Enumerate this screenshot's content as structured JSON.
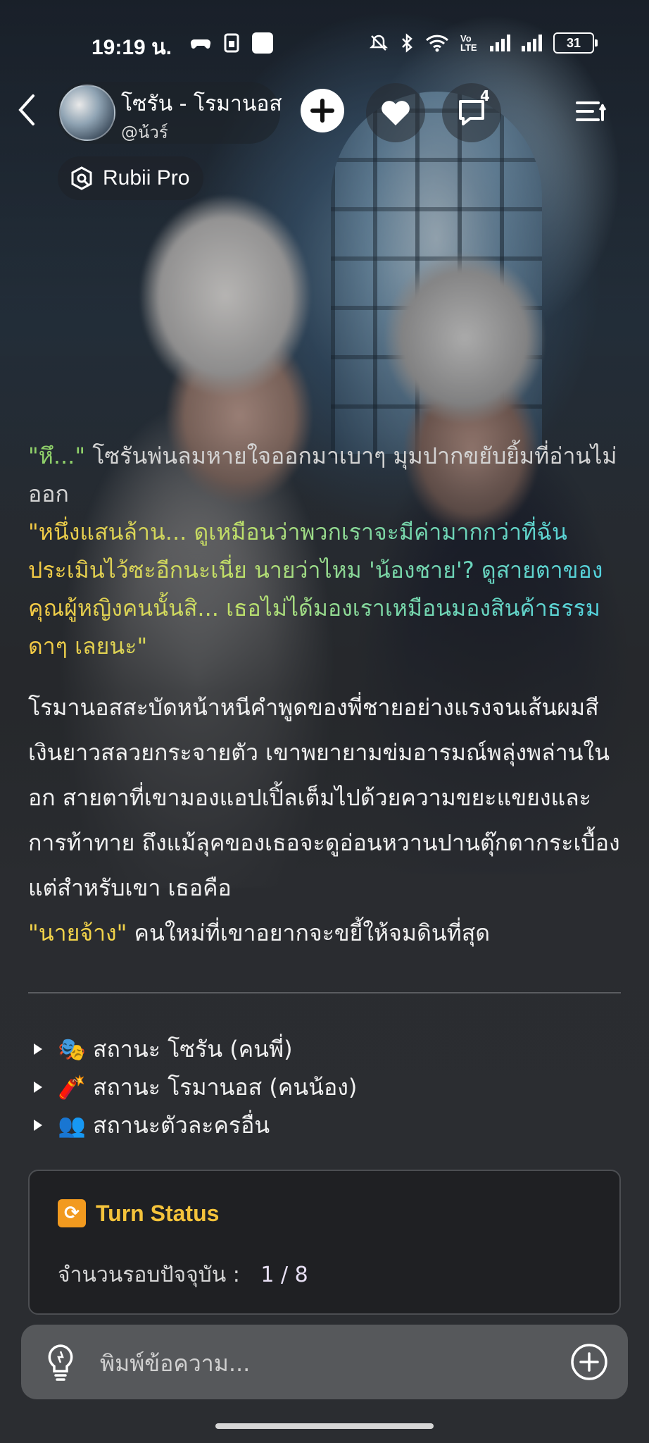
{
  "status_bar": {
    "time": "19:19 น.",
    "battery": "31",
    "network": "Vo LTE"
  },
  "header": {
    "character_name": "โซรัน - โรมานอส",
    "handle": "@น้วร์",
    "chat_badge_count": "4",
    "pro_label": "Rubii Pro"
  },
  "message": {
    "line1_quote": "\"หึ...\"",
    "line1_rest": " โซรันพ่นลมหายใจออกมาเบาๆ มุมปากขยับยิ้มที่อ่านไม่ออก",
    "speech": "\"หนึ่งแสนล้าน... ดูเหมือนว่าพวกเราจะมีค่ามากกว่าที่ฉันประเมินไว้ซะอีกนะเนี่ย นายว่าไหม 'น้องชาย'? ดูสายตาของคุณผู้หญิงคนนั้นสิ... เธอไม่ได้มองเราเหมือนมองสินค้าธรรมดาๆ เลยนะ\"",
    "para2_main": "โรมานอสสะบัดหน้าหนีคำพูดของพี่ชายอย่างแรงจนเส้นผมสีเงินยาวสลวยกระจายตัว เขาพยายามข่มอารมณ์พลุ่งพล่านในอก สายตาที่เขามองแอปเปิ้ลเต็มไปด้วยความขยะแขยงและการท้าทาย ถึงแม้ลุคของเธอจะดูอ่อนหวานปานตุ๊กตากระเบื้อง แต่สำหรับเขา เธอคือ",
    "para2_highlight": "\"นายจ้าง\"",
    "para2_end": " คนใหม่ที่เขาอยากจะขยี้ให้จมดินที่สุด"
  },
  "details": [
    {
      "emoji": "🎭",
      "label": "สถานะ โซรัน (คนพี่)"
    },
    {
      "emoji": "🧨",
      "label": "สถานะ โรมานอส (คนน้อง)"
    },
    {
      "emoji": "👥",
      "label": "สถานะตัวละครอื่น"
    }
  ],
  "turn_status": {
    "title": "Turn Status",
    "label": "จำนวนรอบปัจจุบัน :",
    "value": "1 / 8"
  },
  "input": {
    "placeholder": "พิมพ์ข้อความ..."
  },
  "colors": {
    "speech_green": "#8fd06a",
    "speech_cyan": "#54d6e6",
    "highlight_yellow": "#f2d34a",
    "turn_title": "#f5c33b"
  }
}
